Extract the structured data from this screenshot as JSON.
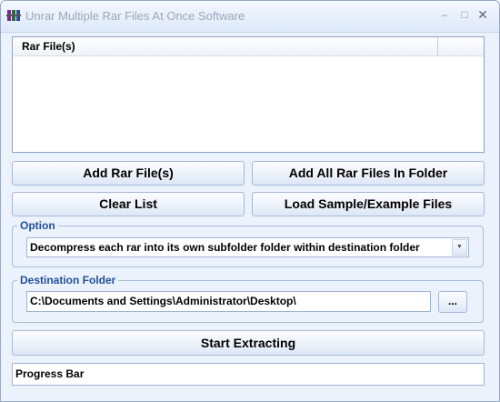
{
  "window": {
    "title": "Unrar Multiple Rar Files At Once Software",
    "controls": {
      "minimize": "–",
      "maximize": "□",
      "close": "✕"
    },
    "icon": "winrar-books-icon"
  },
  "file_list": {
    "column_header": "Rar File(s)",
    "rows": []
  },
  "buttons": {
    "add_rar_files": "Add Rar File(s)",
    "add_all_rar_in_folder": "Add All Rar Files In Folder",
    "clear_list": "Clear List",
    "load_sample_files": "Load Sample/Example Files",
    "browse": "...",
    "start_extracting": "Start Extracting"
  },
  "option": {
    "label": "Option",
    "selected": "Decompress each rar into its own subfolder folder within destination folder"
  },
  "destination": {
    "label": "Destination Folder",
    "path": "C:\\Documents and Settings\\Administrator\\Desktop\\"
  },
  "progress": {
    "label": "Progress Bar",
    "value": 0
  },
  "colors": {
    "window_bg": "#ecf2fc",
    "group_label": "#1f4f9a",
    "border": "#a0b4d3"
  }
}
